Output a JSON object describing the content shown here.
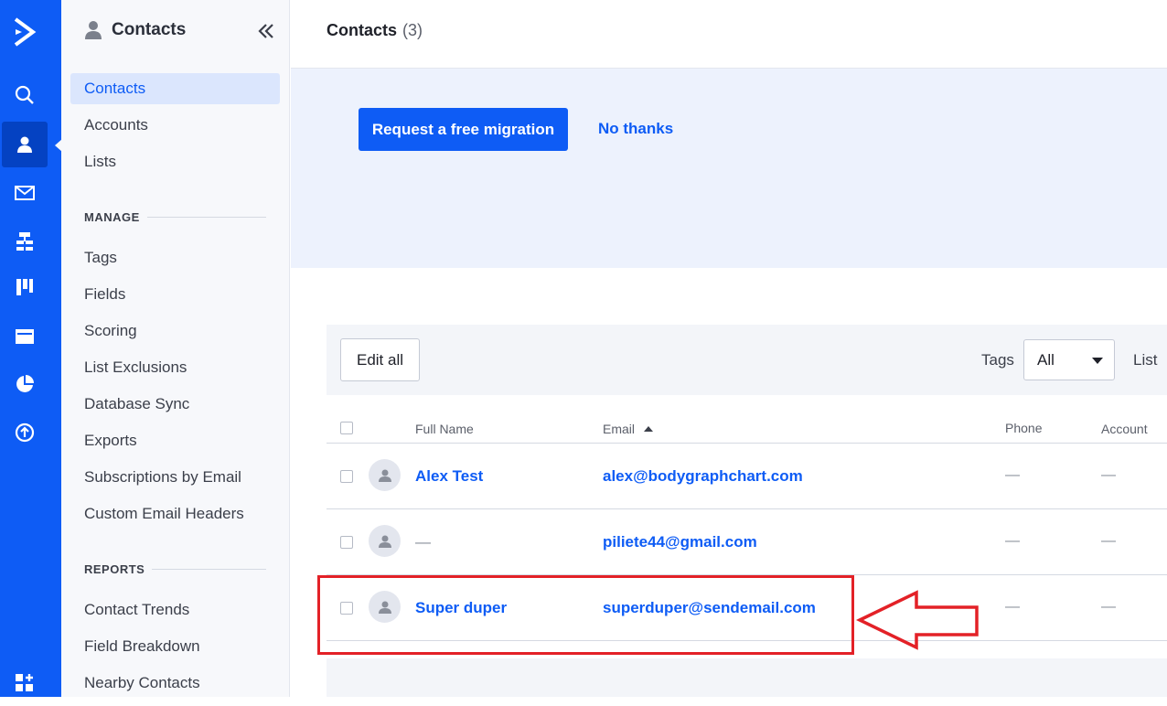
{
  "rail": {
    "items": [
      {
        "name": "logo-icon"
      },
      {
        "name": "search-icon"
      },
      {
        "name": "contacts-icon"
      },
      {
        "name": "email-icon"
      },
      {
        "name": "automations-icon"
      },
      {
        "name": "deals-icon"
      },
      {
        "name": "website-icon"
      },
      {
        "name": "reports-icon"
      },
      {
        "name": "upgrade-icon"
      },
      {
        "name": "apps-icon"
      }
    ],
    "active": "contacts-icon",
    "color": "#0e5cf5"
  },
  "sidebar": {
    "title": "Contacts",
    "items": [
      "Contacts",
      "Accounts",
      "Lists"
    ],
    "manage_label": "MANAGE",
    "manage_items": [
      "Tags",
      "Fields",
      "Scoring",
      "List Exclusions",
      "Database Sync",
      "Exports",
      "Subscriptions by Email",
      "Custom Email Headers"
    ],
    "reports_label": "REPORTS",
    "reports_items": [
      "Contact Trends",
      "Field Breakdown",
      "Nearby Contacts"
    ]
  },
  "topbar": {
    "title": "Contacts",
    "count": "(3)"
  },
  "banner": {
    "primary_button": "Request a free migration",
    "secondary_link": "No thanks"
  },
  "toolbar": {
    "edit_all": "Edit all",
    "tags_label": "Tags",
    "tags_value": "All",
    "list_label": "List"
  },
  "table": {
    "columns": {
      "full_name": "Full Name",
      "email": "Email",
      "phone": "Phone",
      "account": "Account"
    },
    "sort": {
      "column": "Email",
      "direction": "ascending"
    },
    "rows": [
      {
        "name": "Alex Test",
        "email": "alex@bodygraphchart.com",
        "phone": "—",
        "account": "—"
      },
      {
        "name": "—",
        "email": "piliete44@gmail.com",
        "phone": "—",
        "account": "—"
      },
      {
        "name": "Super duper",
        "email": "superduper@sendemail.com",
        "phone": "—",
        "account": "—"
      }
    ]
  },
  "annotation": {
    "highlighted_row": "Super duper",
    "color": "#e32127"
  }
}
